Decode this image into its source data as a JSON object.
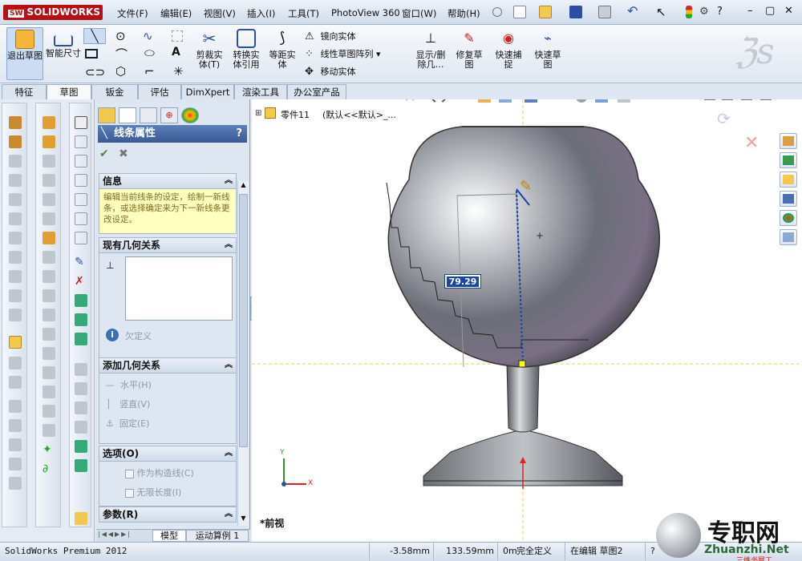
{
  "app": {
    "brand": "SOLIDWORKS",
    "brand_badge": "SW",
    "menus": [
      "文件(F)",
      "编辑(E)",
      "视图(V)",
      "插入(I)",
      "工具(T)",
      "PhotoView 360",
      "窗口(W)",
      "帮助(H)"
    ],
    "window_buttons": [
      "?",
      "–",
      "▢",
      "✕"
    ]
  },
  "commands": {
    "exit_sketch": "退出草图",
    "smart_dim": "智能尺寸",
    "trim": "剪裁实体(T)",
    "convert": "转换实体引用",
    "offset": "等距实体",
    "mirror": "镜向实体",
    "linear_pattern": "线性草图阵列",
    "move": "移动实体",
    "show_delete": "显示/删除几…",
    "repair": "修复草图",
    "quick_snap": "快速捕捉",
    "rapid_sketch": "快速草图"
  },
  "tabs": [
    "特征",
    "草图",
    "钣金",
    "评估",
    "DimXpert",
    "渲染工具",
    "办公室产品"
  ],
  "active_tab": "草图",
  "panel": {
    "title": "线条属性",
    "help": "?",
    "ok": "✔",
    "cancel": "✖",
    "info_title": "信息",
    "info_text": "编辑当前线条的设定，绘制一新线条，或选择确定来为下一新线条更改设定。",
    "existing_title": "现有几何关系",
    "under_defined": "欠定义",
    "add_title": "添加几何关系",
    "horizontal": "水平(H)",
    "vertical": "竖直(V)",
    "fix": "固定(E)",
    "options_title": "选项(O)",
    "construction": "作为构造线(C)",
    "infinite": "无限长度(I)",
    "params_title": "参数(R)"
  },
  "bottom_tabs": [
    "模型",
    "运动算例 1"
  ],
  "viewport": {
    "tree_item": "零件11",
    "tree_config": "(默认<<默认>_...",
    "dimension": "79.29",
    "view_label": "*前视",
    "axis_x": "X",
    "axis_y": "Y"
  },
  "status": {
    "product": "SolidWorks Premium 2012",
    "x": "-3.58mm",
    "y": "133.59mm",
    "z": "0m",
    "state": "完全定义",
    "editing": "在编辑 草图2",
    "help": "?"
  },
  "watermark": {
    "text": "专职网",
    "url": "Zhuanzhi.Net",
    "sub": "三维书屋工"
  },
  "colors": {
    "accent_blue": "#1a44a8",
    "brand_red": "#b80f13",
    "info_yellow": "#ffffc0"
  }
}
